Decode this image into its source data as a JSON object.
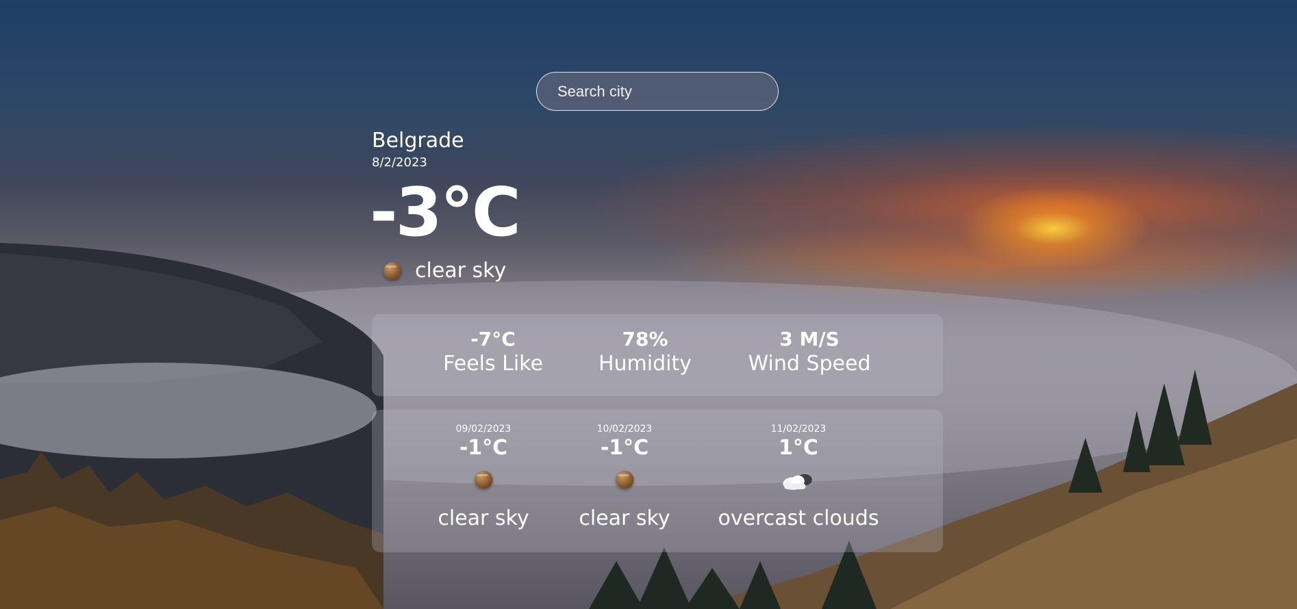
{
  "search": {
    "placeholder": "Search city"
  },
  "current": {
    "city": "Belgrade",
    "date": "8/2/2023",
    "temperature": "-3°C",
    "condition": "clear sky",
    "icon": "planet-icon"
  },
  "details": [
    {
      "value": "-7°C",
      "label": "Feels Like"
    },
    {
      "value": "78%",
      "label": "Humidity"
    },
    {
      "value": "3 M/S",
      "label": "Wind Speed"
    }
  ],
  "forecast": [
    {
      "date": "09/02/2023",
      "temp": "-1°C",
      "condition": "clear sky",
      "icon": "planet-icon"
    },
    {
      "date": "10/02/2023",
      "temp": "-1°C",
      "condition": "clear sky",
      "icon": "planet-icon"
    },
    {
      "date": "11/02/2023",
      "temp": "1°C",
      "condition": "overcast clouds",
      "icon": "cloud-icon"
    }
  ]
}
